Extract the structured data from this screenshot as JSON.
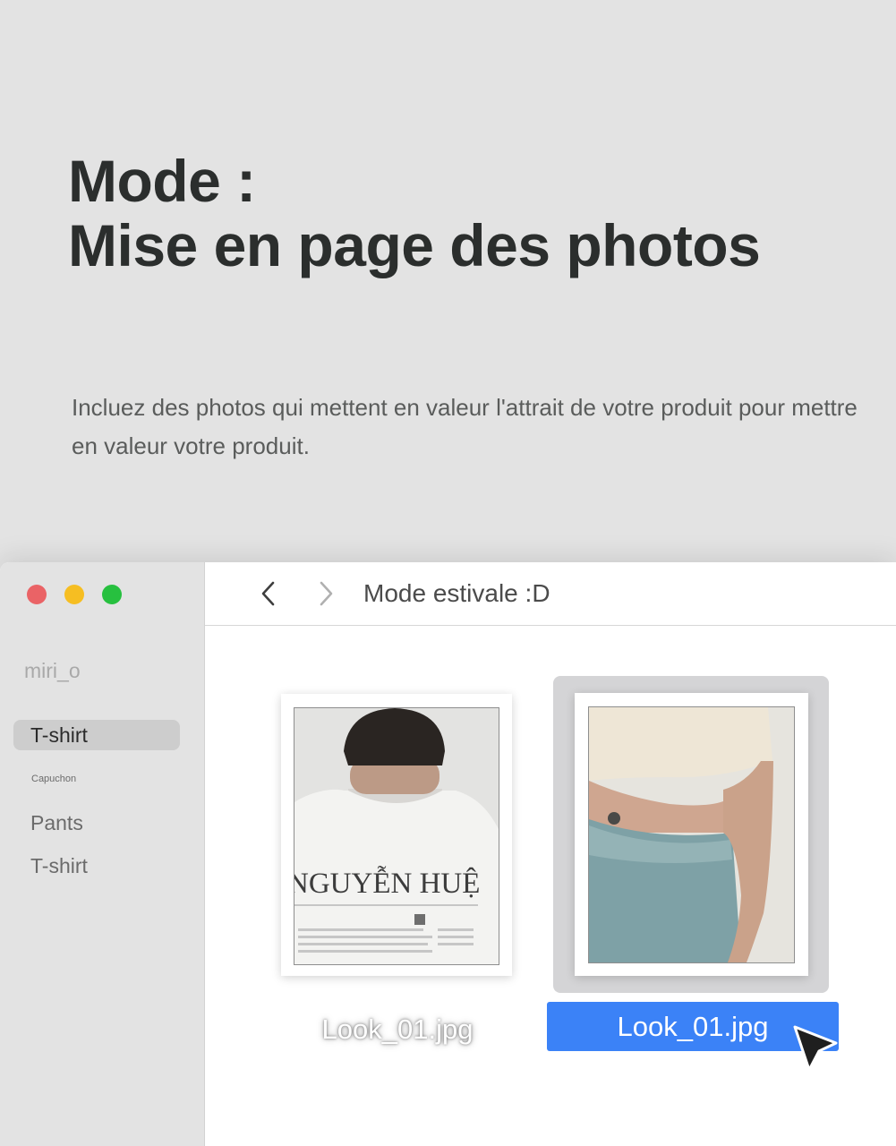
{
  "hero": {
    "title_line1": "Mode :",
    "title_line2": "Mise en page des photos",
    "subtitle": "Incluez des photos qui mettent en valeur l'attrait de votre produit pour mettre en valeur votre produit."
  },
  "window": {
    "traffic_lights": {
      "close": "#ea6366",
      "minimize": "#f6be22",
      "zoom": "#27c03f"
    },
    "sidebar": {
      "account": "miri_o",
      "items": [
        {
          "label": "T-shirt",
          "selected": true
        },
        {
          "label": "Capuchon",
          "selected": false
        },
        {
          "label": "Pants",
          "selected": false
        },
        {
          "label": "T-shirt",
          "selected": false
        }
      ]
    },
    "toolbar": {
      "back_icon": "chevron-left-icon",
      "forward_icon": "chevron-right-icon",
      "folder_title": "Mode estivale :D"
    },
    "files": [
      {
        "name": "Look_01.jpg",
        "selected": false,
        "print_text": "NGUYỄN HUỆ"
      },
      {
        "name": "Look_01.jpg",
        "selected": true
      }
    ],
    "selection_color": "#3b82f7"
  }
}
